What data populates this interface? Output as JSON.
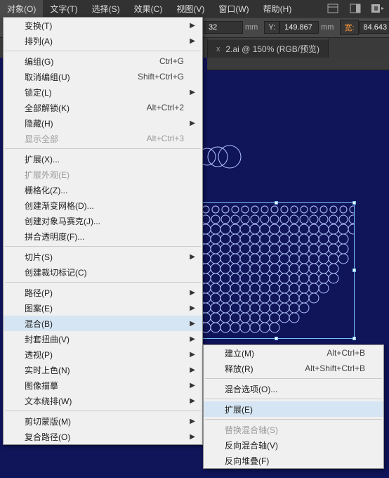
{
  "menubar": {
    "items": [
      "对象(O)",
      "文字(T)",
      "选择(S)",
      "效果(C)",
      "视图(V)",
      "窗口(W)",
      "帮助(H)"
    ],
    "active": 0
  },
  "toolbar": {
    "xval": "32",
    "yLabel": "Y:",
    "yval": "149.867",
    "wLabel": "宽:",
    "wval": "84.643",
    "unit": "mm"
  },
  "tab": {
    "title": "2.ai @ 150% (RGB/预览)",
    "close": "x"
  },
  "menu1": [
    {
      "t": "变换(T)",
      "sub": true
    },
    {
      "t": "排列(A)",
      "sub": true
    },
    {
      "sep": true
    },
    {
      "t": "编组(G)",
      "sc": "Ctrl+G"
    },
    {
      "t": "取消编组(U)",
      "sc": "Shift+Ctrl+G"
    },
    {
      "t": "锁定(L)",
      "sub": true
    },
    {
      "t": "全部解锁(K)",
      "sc": "Alt+Ctrl+2"
    },
    {
      "t": "隐藏(H)",
      "sub": true
    },
    {
      "t": "显示全部",
      "sc": "Alt+Ctrl+3",
      "dis": true
    },
    {
      "sep": true
    },
    {
      "t": "扩展(X)..."
    },
    {
      "t": "扩展外观(E)",
      "dis": true
    },
    {
      "t": "栅格化(Z)..."
    },
    {
      "t": "创建渐变网格(D)..."
    },
    {
      "t": "创建对象马赛克(J)..."
    },
    {
      "t": "拼合透明度(F)..."
    },
    {
      "sep": true
    },
    {
      "t": "切片(S)",
      "sub": true
    },
    {
      "t": "创建裁切标记(C)"
    },
    {
      "sep": true
    },
    {
      "t": "路径(P)",
      "sub": true
    },
    {
      "t": "图案(E)",
      "sub": true
    },
    {
      "t": "混合(B)",
      "sub": true,
      "hi": true
    },
    {
      "t": "封套扭曲(V)",
      "sub": true
    },
    {
      "t": "透视(P)",
      "sub": true
    },
    {
      "t": "实时上色(N)",
      "sub": true
    },
    {
      "t": "图像描摹",
      "sub": true
    },
    {
      "t": "文本绕排(W)",
      "sub": true
    },
    {
      "sep": true
    },
    {
      "t": "剪切蒙版(M)",
      "sub": true
    },
    {
      "t": "复合路径(O)",
      "sub": true
    }
  ],
  "menu2": [
    {
      "t": "建立(M)",
      "sc": "Alt+Ctrl+B"
    },
    {
      "t": "释放(R)",
      "sc": "Alt+Shift+Ctrl+B"
    },
    {
      "sep": true
    },
    {
      "t": "混合选项(O)..."
    },
    {
      "sep": true
    },
    {
      "t": "扩展(E)",
      "hi": true
    },
    {
      "sep": true
    },
    {
      "t": "替换混合轴(S)",
      "dis": true
    },
    {
      "t": "反向混合轴(V)"
    },
    {
      "t": "反向堆叠(F)"
    }
  ]
}
